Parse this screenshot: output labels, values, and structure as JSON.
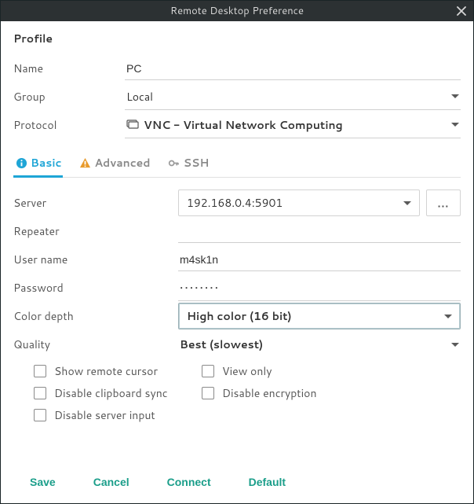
{
  "window": {
    "title": "Remote Desktop Preference"
  },
  "profile": {
    "heading": "Profile",
    "name_label": "Name",
    "name_value": "PC",
    "group_label": "Group",
    "group_value": "Local",
    "protocol_label": "Protocol",
    "protocol_value": "VNC - Virtual Network Computing"
  },
  "tabs": {
    "basic": "Basic",
    "advanced": "Advanced",
    "ssh": "SSH"
  },
  "basic": {
    "server_label": "Server",
    "server_value": "192.168.0.4:5901",
    "more_label": "...",
    "repeater_label": "Repeater",
    "repeater_value": "",
    "username_label": "User name",
    "username_value": "m4sk1n",
    "password_label": "Password",
    "password_value": "••••••••",
    "colordepth_label": "Color depth",
    "colordepth_value": "High color (16 bit)",
    "quality_label": "Quality",
    "quality_value": "Best (slowest)",
    "checks": {
      "show_remote_cursor": "Show remote cursor",
      "disable_clipboard_sync": "Disable clipboard sync",
      "disable_server_input": "Disable server input",
      "view_only": "View only",
      "disable_encryption": "Disable encryption"
    }
  },
  "footer": {
    "save": "Save",
    "cancel": "Cancel",
    "connect": "Connect",
    "default": "Default"
  }
}
